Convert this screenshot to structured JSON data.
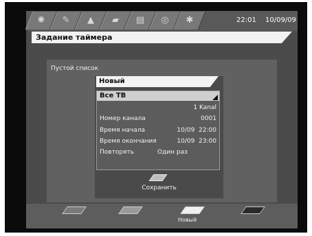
{
  "header": {
    "tabs": [
      {
        "icon": "satellite-icon",
        "glyph": "✺"
      },
      {
        "icon": "tools-icon",
        "glyph": "✎"
      },
      {
        "icon": "signal-icon",
        "glyph": "▲"
      },
      {
        "icon": "movie-icon",
        "glyph": "▰"
      },
      {
        "icon": "media-icon",
        "glyph": "▤"
      },
      {
        "icon": "disc-icon",
        "glyph": "◎"
      },
      {
        "icon": "sync-icon",
        "glyph": "✱"
      }
    ],
    "time": "22:01",
    "date": "10/09/09"
  },
  "window_title": "Задание таймера",
  "main": {
    "empty_list_label": "Пустой список",
    "selected_entry": "Новый",
    "channel_list_select": "Все ТВ",
    "channel_name": "1 Kanal",
    "fields": {
      "channel_number": {
        "label": "Номер канала",
        "value": "0001"
      },
      "start_time": {
        "label": "Время начала",
        "value": "10/09  22:00"
      },
      "end_time": {
        "label": "Время окончания",
        "value": "10/09  23:00"
      },
      "repeat": {
        "label": "Повторять",
        "value": "Один раз"
      }
    },
    "save_label": "Сохранить"
  },
  "footer": {
    "keys": [
      {
        "name": "red-key",
        "color": "#7a7a7a",
        "label": ""
      },
      {
        "name": "green-key",
        "color": "#9a9a9a",
        "label": ""
      },
      {
        "name": "yellow-key",
        "color": "#f0f0f0",
        "label": "Новый"
      },
      {
        "name": "blue-key",
        "color": "#2a2a2a",
        "label": ""
      }
    ]
  }
}
